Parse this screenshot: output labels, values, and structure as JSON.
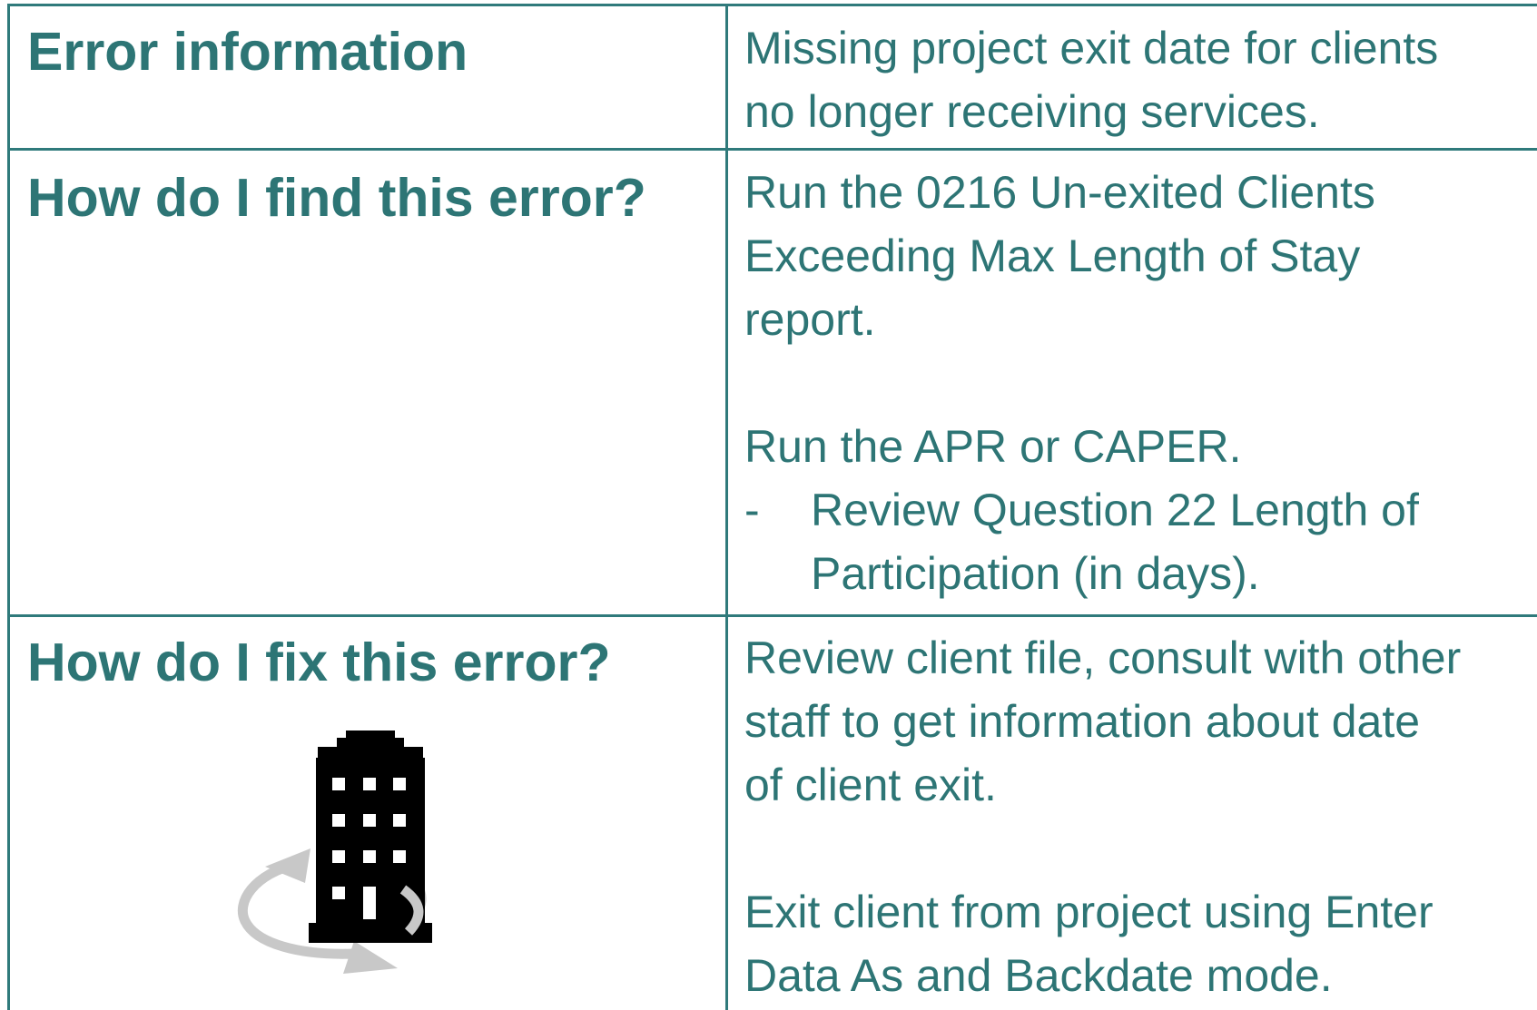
{
  "rows": [
    {
      "label": "Error information",
      "lines": [
        "Missing project exit date for clients",
        "no longer receiving services."
      ]
    },
    {
      "label": "How do I find this error?",
      "lines": [
        "Run the 0216 Un-exited Clients",
        "Exceeding Max Length of Stay",
        "report.",
        "",
        "Run the APR or CAPER."
      ],
      "bullet": {
        "marker": "-",
        "lines": [
          "Review Question 22 Length of",
          "Participation (in days)."
        ]
      }
    },
    {
      "label": "How do I fix this error?",
      "lines": [
        "Review client file, consult with other",
        "staff to get information about date",
        "of client exit.",
        "",
        "Exit client from project using Enter",
        "Data As and Backdate mode."
      ],
      "icon": "building-refresh-icon"
    }
  ],
  "colors": {
    "border": "#2f7a7b",
    "text": "#2d7575",
    "icon": "#000000",
    "icon_arrows": "#c8c8c8"
  }
}
